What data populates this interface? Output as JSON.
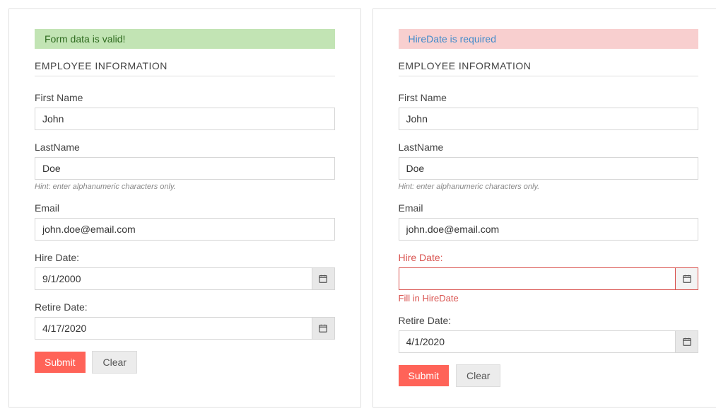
{
  "formLeft": {
    "banner": {
      "text": "Form data is valid!",
      "type": "success"
    },
    "sectionTitle": "EMPLOYEE INFORMATION",
    "firstName": {
      "label": "First Name",
      "value": "John"
    },
    "lastName": {
      "label": "LastName",
      "value": "Doe",
      "hint": "Hint: enter alphanumeric characters only."
    },
    "email": {
      "label": "Email",
      "value": "john.doe@email.com"
    },
    "hireDate": {
      "label": "Hire Date:",
      "value": "9/1/2000"
    },
    "retireDate": {
      "label": "Retire Date:",
      "value": "4/17/2020"
    },
    "buttons": {
      "submit": "Submit",
      "clear": "Clear"
    }
  },
  "formRight": {
    "banner": {
      "text": "HireDate is required",
      "type": "error"
    },
    "sectionTitle": "EMPLOYEE INFORMATION",
    "firstName": {
      "label": "First Name",
      "value": "John"
    },
    "lastName": {
      "label": "LastName",
      "value": "Doe",
      "hint": "Hint: enter alphanumeric characters only."
    },
    "email": {
      "label": "Email",
      "value": "john.doe@email.com"
    },
    "hireDate": {
      "label": "Hire Date:",
      "value": "",
      "error": "Fill in HireDate"
    },
    "retireDate": {
      "label": "Retire Date:",
      "value": "4/1/2020"
    },
    "buttons": {
      "submit": "Submit",
      "clear": "Clear"
    }
  }
}
